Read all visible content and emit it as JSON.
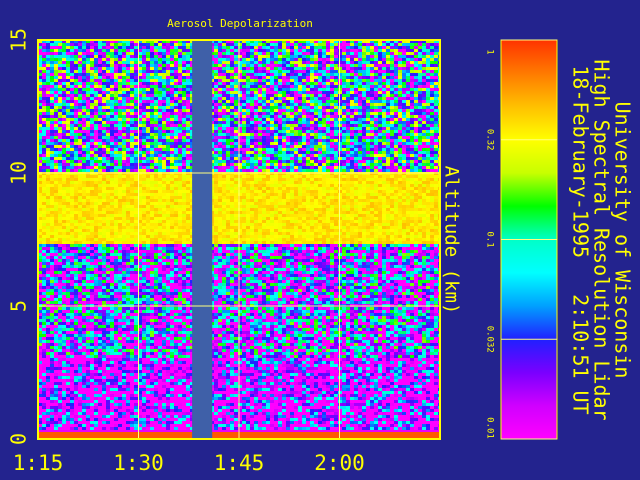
{
  "chart_data": {
    "type": "heatmap",
    "title": "Aerosol Depolarization",
    "ylabel": "Altitude (km)",
    "xlabel": "",
    "x_ticks": [
      "1:15",
      "1:30",
      "1:45",
      "2:00"
    ],
    "y_ticks": [
      0,
      5,
      10,
      15
    ],
    "ylim": [
      0,
      15
    ],
    "x_range": [
      "1:15",
      "2:15"
    ],
    "grid": true,
    "data_gap": {
      "start": "1:38",
      "end": "1:41"
    },
    "layers": [
      {
        "name": "aerosol layer",
        "bottom_km": 7.3,
        "top_km": 10.0,
        "depolarization": 0.35
      },
      {
        "name": "upper noise",
        "bottom_km": 10.0,
        "top_km": 15.0,
        "depolarization": 0.05
      },
      {
        "name": "mid noise",
        "bottom_km": 3.0,
        "top_km": 7.3,
        "depolarization": 0.03
      },
      {
        "name": "lower layer",
        "bottom_km": 0.3,
        "top_km": 3.0,
        "depolarization": 0.015
      }
    ],
    "colorbar": {
      "scale": "log",
      "min": 0.01,
      "max": 1,
      "tick_labels": [
        "1",
        "0.32",
        "0.1",
        "0.032",
        "0.01"
      ],
      "colors": [
        "#ff3300",
        "#ff7a00",
        "#ffc000",
        "#ffff00",
        "#c8ff00",
        "#00ff00",
        "#00ffc8",
        "#00ffff",
        "#00a0ff",
        "#2020ff",
        "#7a00ff",
        "#d000ff",
        "#ff00ff"
      ]
    },
    "colors": {
      "background": "#23238e",
      "frame": "#ffff00",
      "labels": "#ffff00",
      "gap": "#3f60a8"
    }
  },
  "header": {
    "institution": "University of Wisconsin",
    "instrument": "High Spectral Resolution Lidar",
    "timestamp": "18-February-1995   2:10:51 UT"
  }
}
